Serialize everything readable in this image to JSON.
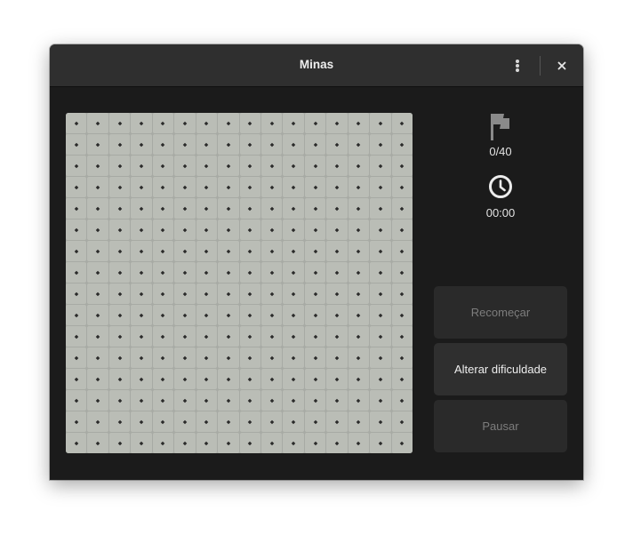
{
  "window": {
    "title": "Minas",
    "menu_icon": "vertical-ellipsis-icon",
    "close_icon": "close-icon"
  },
  "board": {
    "rows": 16,
    "columns": 16,
    "cell_state": "unrevealed"
  },
  "stats": {
    "flag_icon": "flag-icon",
    "flags": "0/40",
    "clock_icon": "clock-icon",
    "time": "00:00"
  },
  "buttons": {
    "restart": "Recomeçar",
    "change_difficulty": "Alterar dificuldade",
    "pause": "Pausar"
  },
  "colors": {
    "headerbar": "#2f2f2f",
    "window_bg": "#1b1b1b",
    "tile": "#babdb6",
    "button": "#2f2f2f"
  }
}
